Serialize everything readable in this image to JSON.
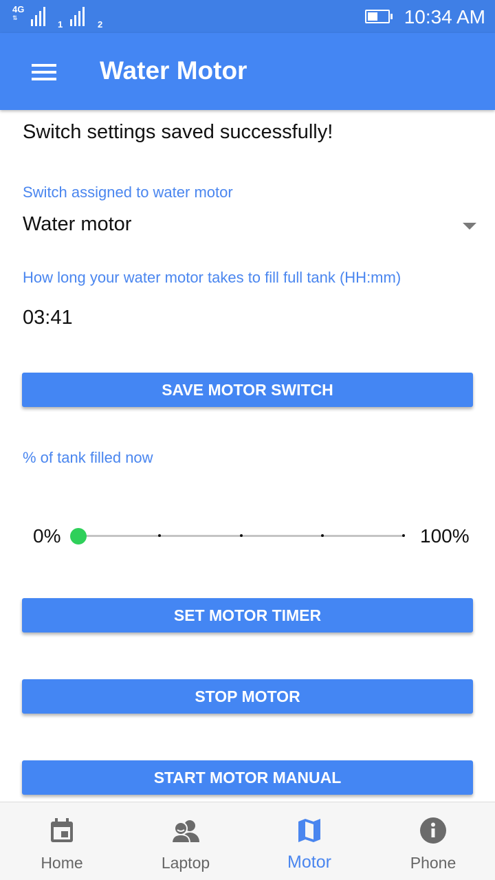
{
  "status_bar": {
    "network": "4G",
    "sim1": "1",
    "sim2": "2",
    "time": "10:34 AM",
    "battery_level": 0.5
  },
  "app_bar": {
    "title": "Water Motor",
    "menu_icon": "hamburger-menu-icon"
  },
  "main": {
    "message": "Switch settings saved successfully!",
    "switch_label": "Switch assigned to water motor",
    "switch_value": "Water motor",
    "duration_label": "How long your water motor takes to fill full tank (HH:mm)",
    "duration_value": "03:41",
    "save_button": "SAVE MOTOR SWITCH",
    "tank_label": "% of tank filled now",
    "slider": {
      "min_label": "0%",
      "max_label": "100%",
      "value": 0,
      "steps": 4,
      "thumb_color": "#2fd05a"
    },
    "timer_button": "SET MOTOR TIMER",
    "stop_button": "STOP MOTOR",
    "start_button": "START MOTOR MANUAL"
  },
  "bottom_nav": {
    "items": [
      {
        "label": "Home",
        "icon": "calendar-icon",
        "active": false
      },
      {
        "label": "Laptop",
        "icon": "people-icon",
        "active": false
      },
      {
        "label": "Motor",
        "icon": "map-icon",
        "active": true
      },
      {
        "label": "Phone",
        "icon": "info-icon",
        "active": false
      }
    ]
  },
  "colors": {
    "primary": "#4486f3",
    "status_bar": "#3f7fe6",
    "accent_text": "#4a86ef",
    "inactive_icon": "#6b6b6b"
  }
}
